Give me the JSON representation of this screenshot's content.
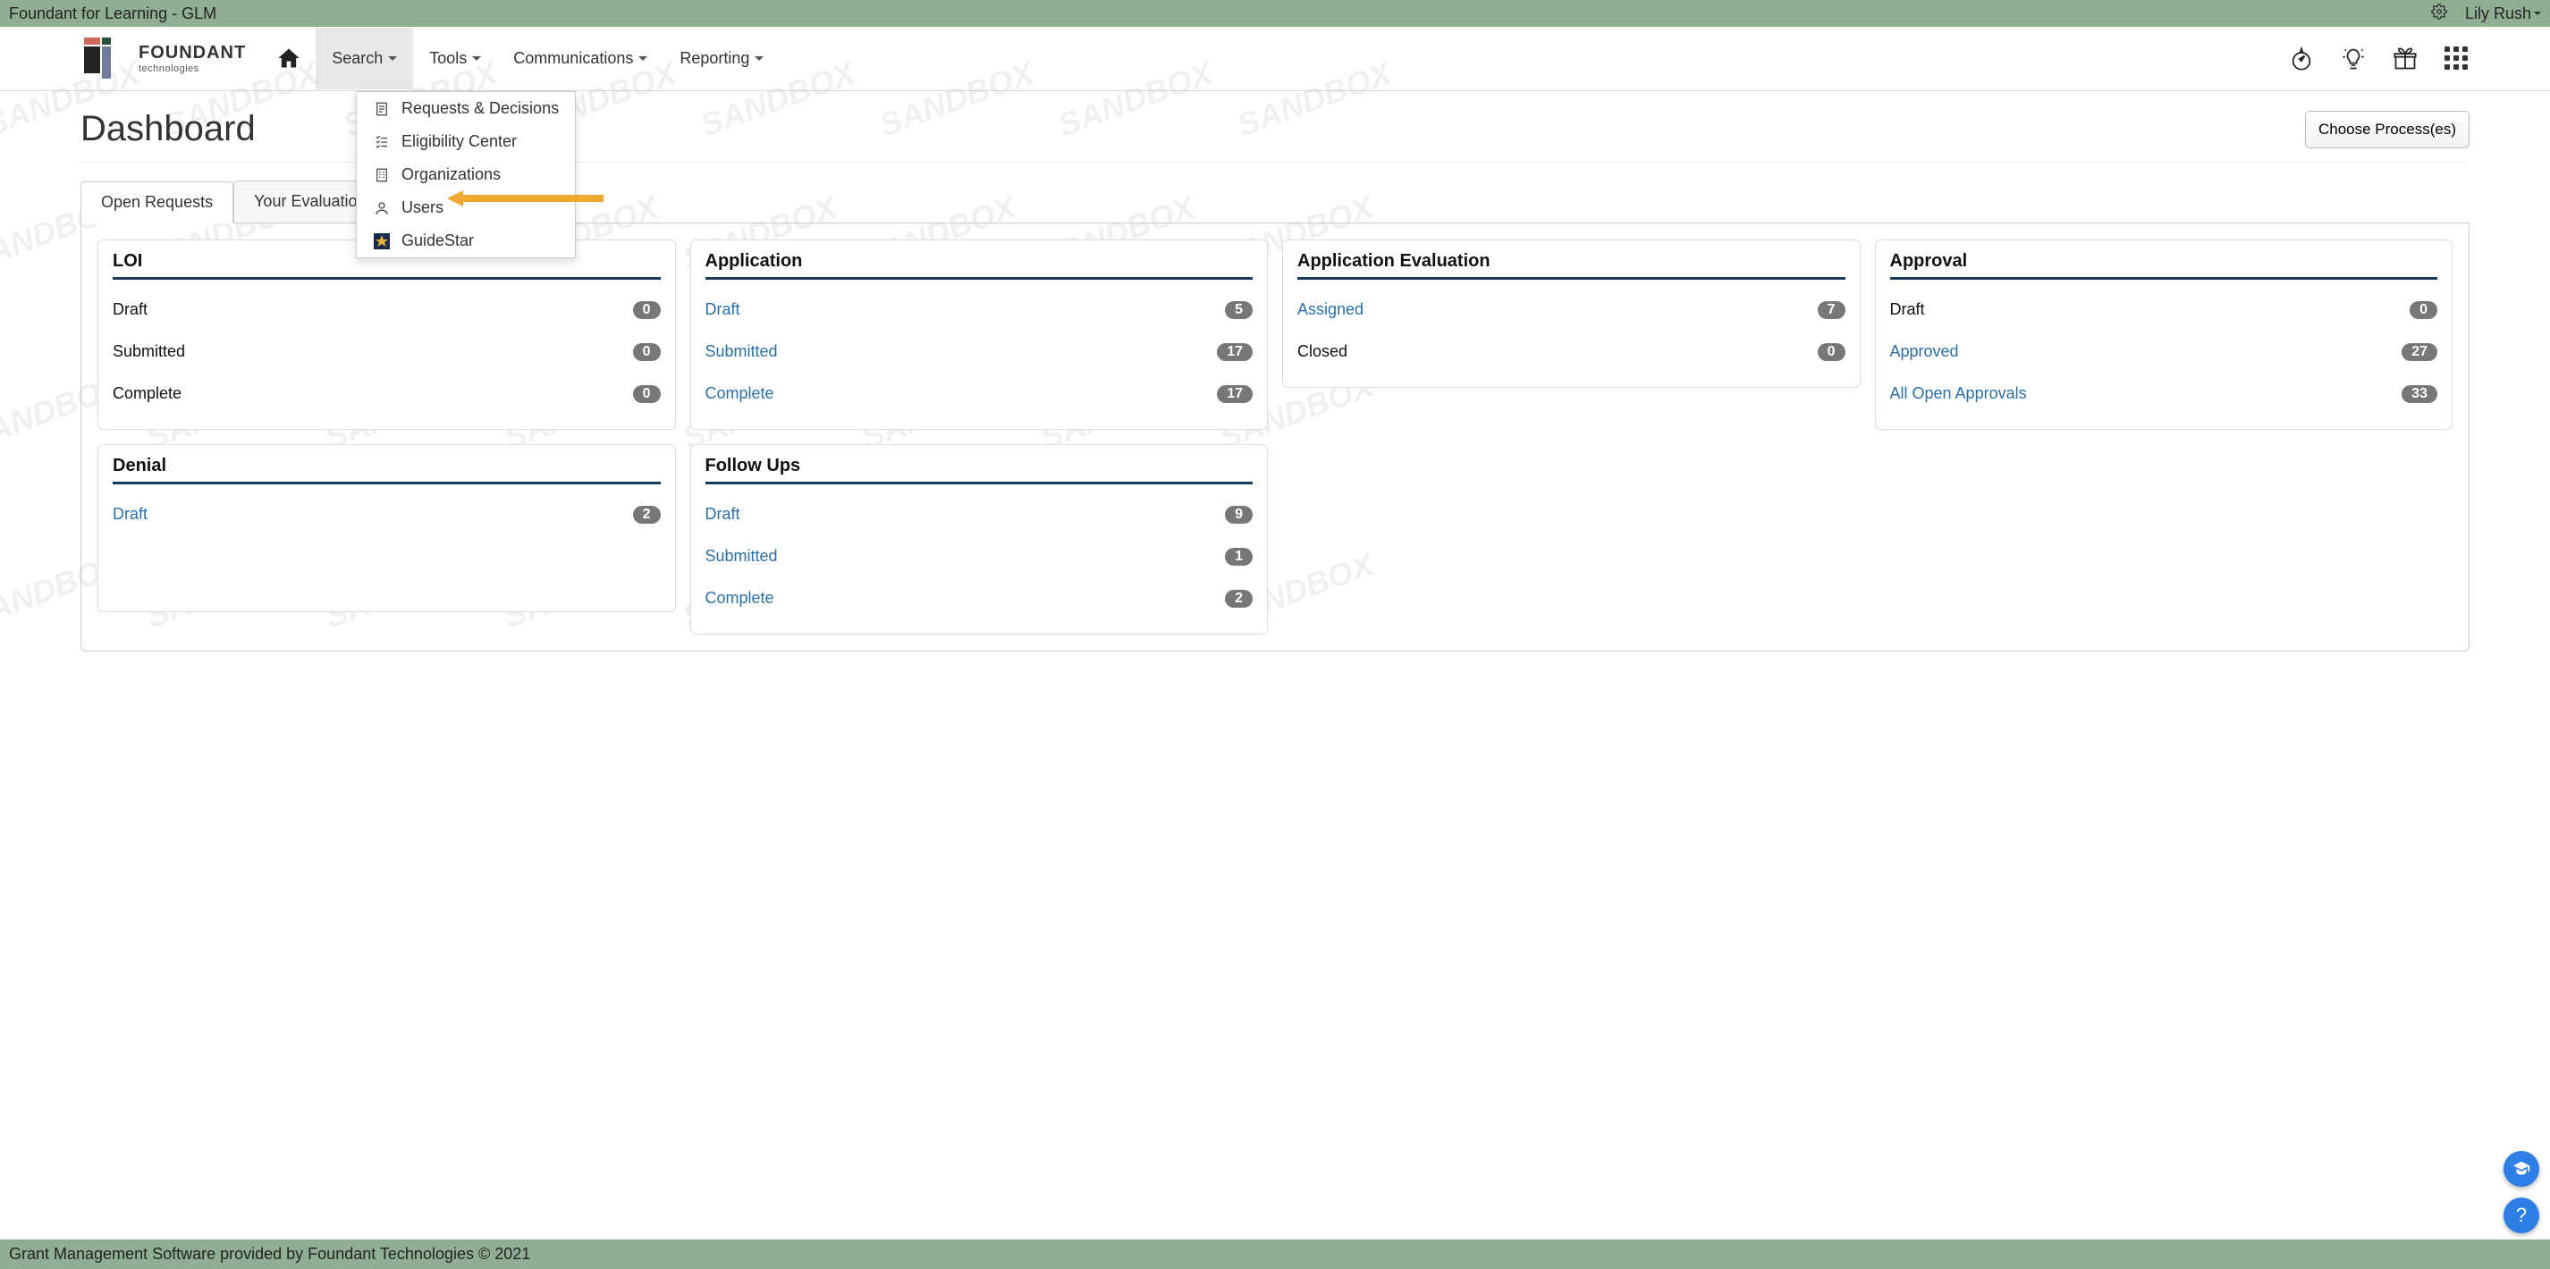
{
  "topbar": {
    "title": "Foundant for Learning - GLM",
    "user_name": "Lily Rush"
  },
  "logo": {
    "brand": "FOUNDANT",
    "tagline": "technologies"
  },
  "nav": {
    "search": "Search",
    "tools": "Tools",
    "communications": "Communications",
    "reporting": "Reporting"
  },
  "search_dropdown": {
    "requests_decisions": "Requests & Decisions",
    "eligibility_center": "Eligibility Center",
    "organizations": "Organizations",
    "users": "Users",
    "guidestar": "GuideStar"
  },
  "page": {
    "title": "Dashboard",
    "choose_processes": "Choose Process(es)"
  },
  "tabs": {
    "open_requests": "Open Requests",
    "your_evaluations": "Your Evaluations"
  },
  "cards": {
    "loi": {
      "title": "LOI",
      "draft_label": "Draft",
      "draft_count": "0",
      "submitted_label": "Submitted",
      "submitted_count": "0",
      "complete_label": "Complete",
      "complete_count": "0"
    },
    "application": {
      "title": "Application",
      "draft_label": "Draft",
      "draft_count": "5",
      "submitted_label": "Submitted",
      "submitted_count": "17",
      "complete_label": "Complete",
      "complete_count": "17"
    },
    "app_eval": {
      "title": "Application Evaluation",
      "assigned_label": "Assigned",
      "assigned_count": "7",
      "closed_label": "Closed",
      "closed_count": "0"
    },
    "approval": {
      "title": "Approval",
      "draft_label": "Draft",
      "draft_count": "0",
      "approved_label": "Approved",
      "approved_count": "27",
      "all_open_label": "All Open Approvals",
      "all_open_count": "33"
    },
    "denial": {
      "title": "Denial",
      "draft_label": "Draft",
      "draft_count": "2"
    },
    "followups": {
      "title": "Follow Ups",
      "draft_label": "Draft",
      "draft_count": "9",
      "submitted_label": "Submitted",
      "submitted_count": "1",
      "complete_label": "Complete",
      "complete_count": "2"
    }
  },
  "footer": {
    "text": "Grant Management Software provided by Foundant Technologies © 2021"
  },
  "watermark": "SANDBOX"
}
